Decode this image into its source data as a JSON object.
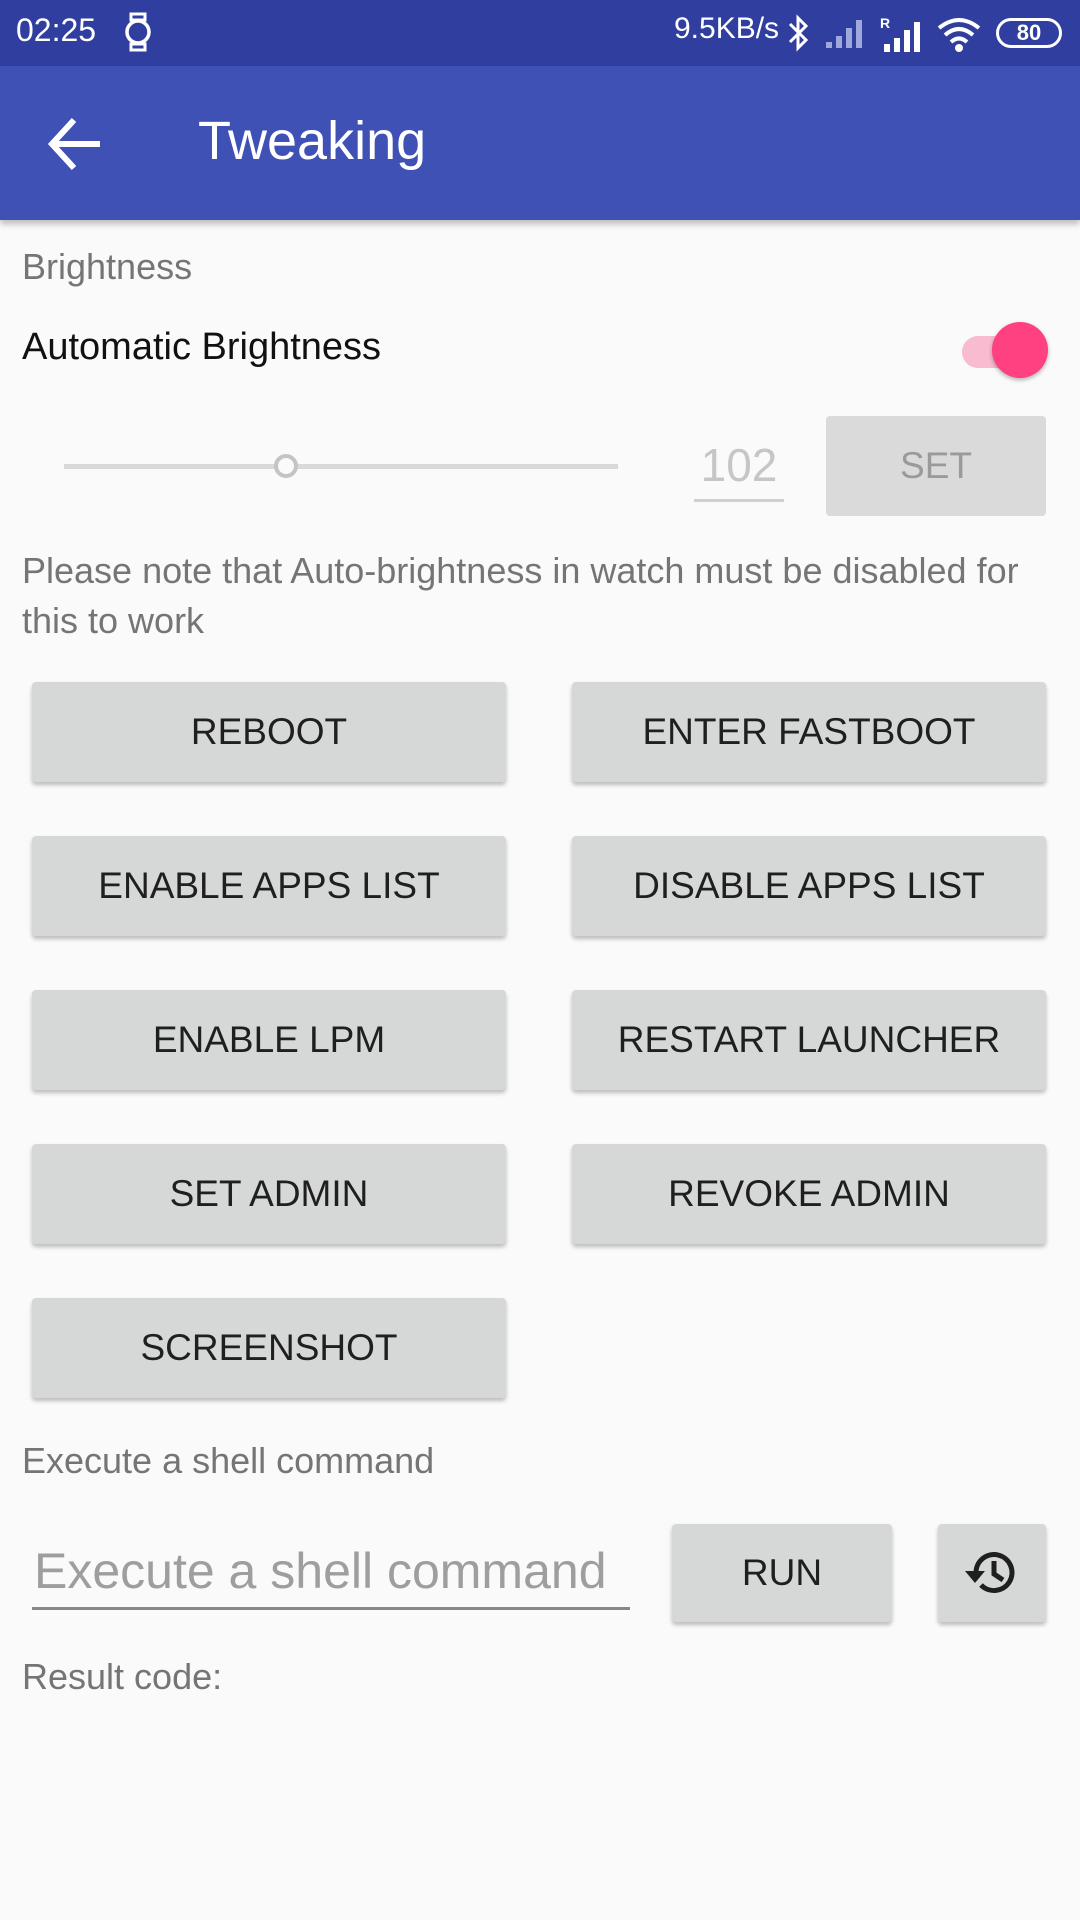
{
  "status_bar": {
    "time": "02:25",
    "network_speed": "9.5KB/s",
    "battery_level": "80",
    "icons": [
      "watch-icon",
      "bluetooth-icon",
      "signal-icon",
      "roaming-signal-icon",
      "wifi-icon",
      "battery-icon"
    ]
  },
  "app_bar": {
    "title": "Tweaking",
    "back_icon": "arrow-back-icon",
    "background_color": "#3f51b5"
  },
  "brightness": {
    "section_label": "Brightness",
    "auto_label": "Automatic Brightness",
    "auto_enabled": true,
    "value": "102",
    "slider_fraction": 0.4,
    "set_label": "SET",
    "note": "Please note that Auto-brightness in watch must be disabled for this to work",
    "accent_color": "#ff4081"
  },
  "actions": {
    "reboot": "REBOOT",
    "enter_fastboot": "ENTER FASTBOOT",
    "enable_apps_list": "ENABLE APPS LIST",
    "disable_apps_list": "DISABLE APPS LIST",
    "enable_lpm": "ENABLE LPM",
    "restart_launcher": "RESTART LAUNCHER",
    "set_admin": "SET ADMIN",
    "revoke_admin": "REVOKE ADMIN",
    "screenshot": "SCREENSHOT"
  },
  "shell": {
    "section_label": "Execute a shell command",
    "placeholder": "Execute a shell command",
    "run_label": "RUN",
    "history_icon": "history-icon",
    "result_label": "Result code:"
  }
}
